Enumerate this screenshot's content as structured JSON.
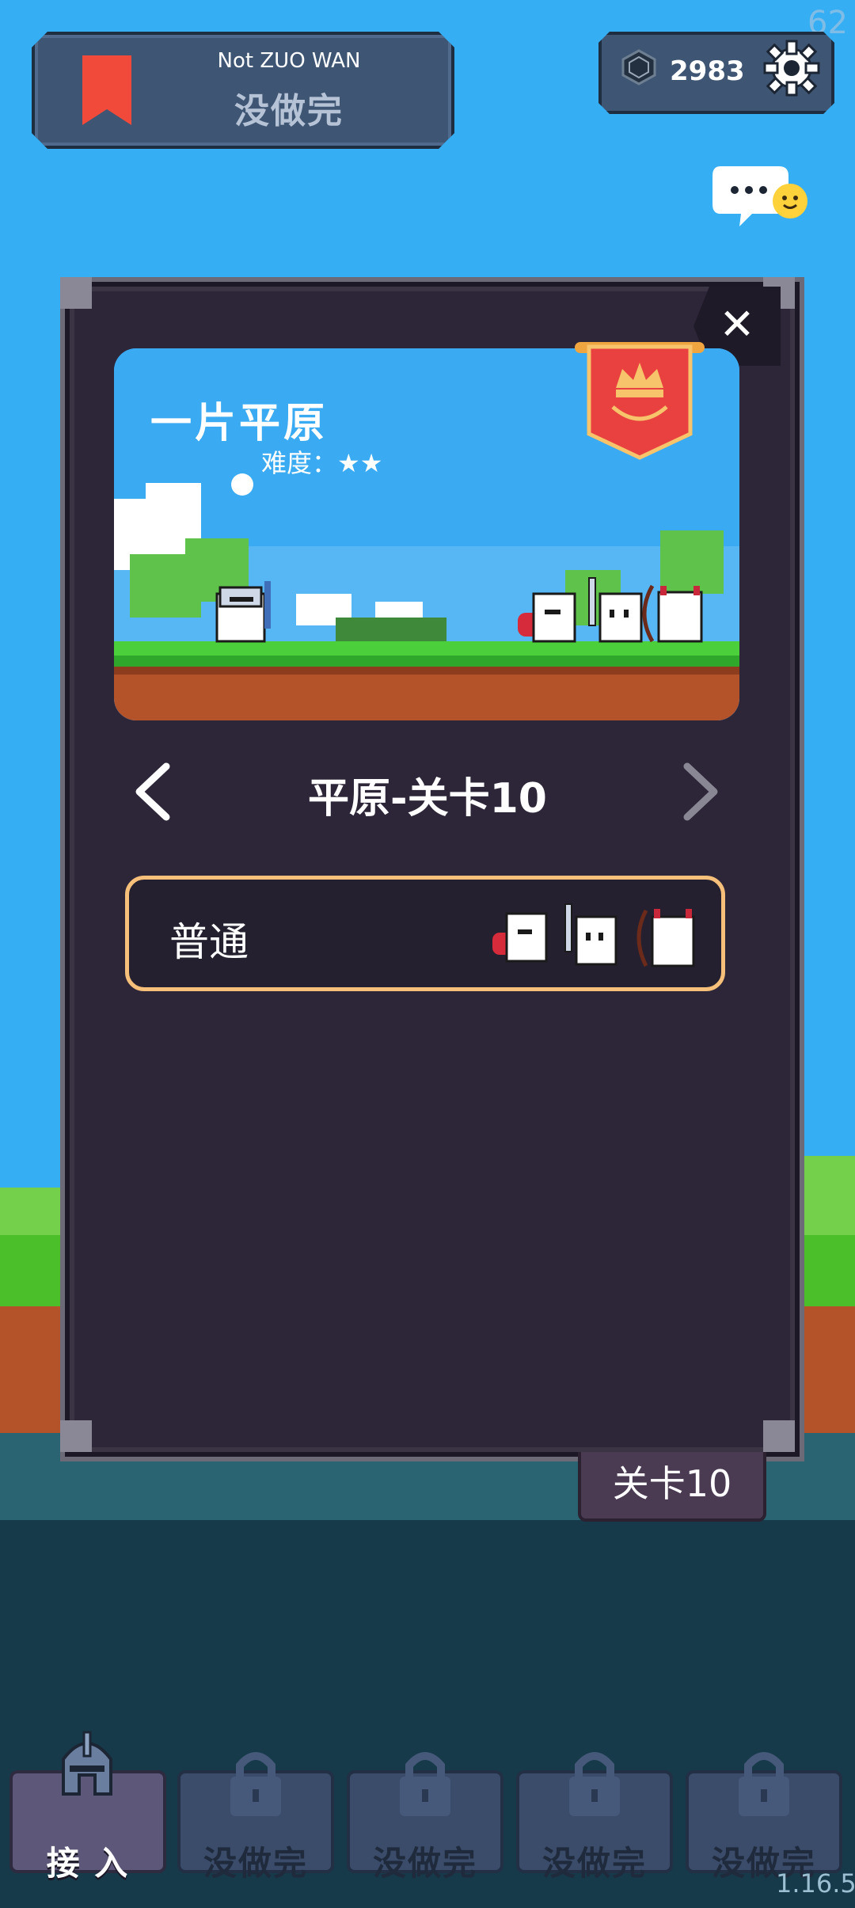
{
  "hud": {
    "fps": "62",
    "quest": {
      "title": "Not ZUO WAN",
      "subtitle": "没做完"
    },
    "currency": {
      "value": "2983",
      "icon": "gem-icon"
    },
    "settings_icon": "gear-icon",
    "chat_icon": "chat-bubble-icon"
  },
  "modal": {
    "close_label": "✕",
    "level_name": "一片平原",
    "difficulty": "难度：★★",
    "level_title": "平原-关卡10",
    "mode": {
      "label": "普通"
    }
  },
  "level_tag": "关卡10",
  "bottom_bar": {
    "tabs": [
      {
        "label": "接 入",
        "active": true,
        "icon": "knight-helmet-icon"
      },
      {
        "label": "没做完",
        "locked": true,
        "icon": "lock-icon"
      },
      {
        "label": "没做完",
        "locked": true,
        "icon": "lock-icon"
      },
      {
        "label": "没做完",
        "locked": true,
        "icon": "lock-icon"
      },
      {
        "label": "没做完",
        "locked": true,
        "icon": "lock-icon"
      }
    ]
  },
  "version": "1.16.5",
  "colors": {
    "sky": "#36aef4",
    "modal_bg": "#2d2538",
    "mode_border": "#f6c07a",
    "banner_red": "#e8413f",
    "tab_bg": "#3a4c6a"
  }
}
